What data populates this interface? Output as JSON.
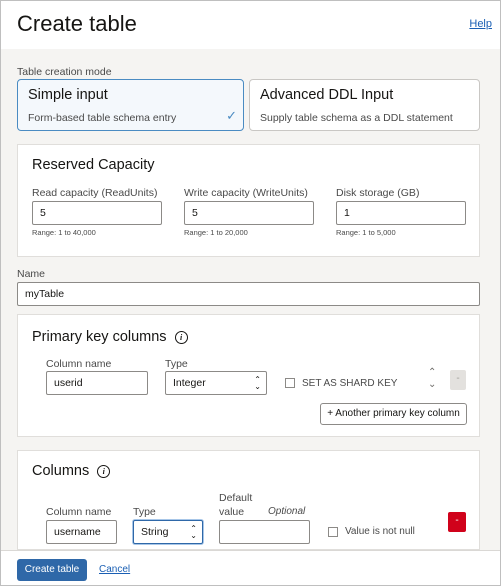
{
  "page": {
    "title": "Create table",
    "help_label": "Help"
  },
  "mode": {
    "label": "Table creation mode",
    "simple": {
      "title": "Simple input",
      "desc": "Form-based table schema entry"
    },
    "advanced": {
      "title": "Advanced DDL Input",
      "desc": "Supply table schema as a DDL statement"
    }
  },
  "capacity": {
    "title": "Reserved Capacity",
    "read": {
      "label": "Read capacity (ReadUnits)",
      "value": "5",
      "hint": "Range: 1 to 40,000"
    },
    "write": {
      "label": "Write capacity (WriteUnits)",
      "value": "5",
      "hint": "Range: 1 to 20,000"
    },
    "storage": {
      "label": "Disk storage (GB)",
      "value": "1",
      "hint": "Range: 1 to 5,000"
    }
  },
  "name": {
    "label": "Name",
    "value": "myTable"
  },
  "pk": {
    "title": "Primary key columns",
    "col_label": "Column name",
    "type_label": "Type",
    "col_value": "userid",
    "type_value": "Integer",
    "shard_label": "SET AS SHARD KEY",
    "add_label": "+ Another primary key column"
  },
  "columns": {
    "title": "Columns",
    "col_label": "Column name",
    "type_label": "Type",
    "default_label_1": "Default",
    "default_label_2": "value",
    "optional": "Optional",
    "col_value": "username",
    "type_value": "String",
    "notnull_label": "Value is not null"
  },
  "footer": {
    "create_label": "Create table",
    "cancel_label": "Cancel"
  },
  "colors": {
    "accent": "#2f68a8",
    "danger": "#d0021b",
    "link": "#1a5fb4"
  }
}
